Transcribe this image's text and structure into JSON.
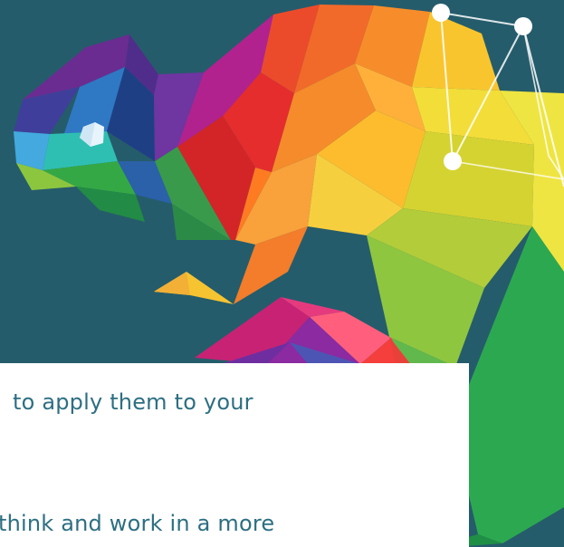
{
  "artwork": {
    "icon": "chameleon-low-poly-logo",
    "background_color": "#255c6b",
    "palette": {
      "purple": "#6a2c91",
      "indigo": "#3f3f9b",
      "blue": "#2f78c4",
      "cyan": "#43a9df",
      "teal": "#2fbfb2",
      "green": "#35a846",
      "lime": "#8cc63f",
      "yellow": "#f2d531",
      "orange": "#f58b2a",
      "red": "#e52d2d",
      "magenta": "#d72c7a",
      "pink": "#ff5f7d",
      "white": "#ffffff"
    }
  },
  "text_card": {
    "line_1": "to apply them to your",
    "line_2": "think and work in a more"
  }
}
